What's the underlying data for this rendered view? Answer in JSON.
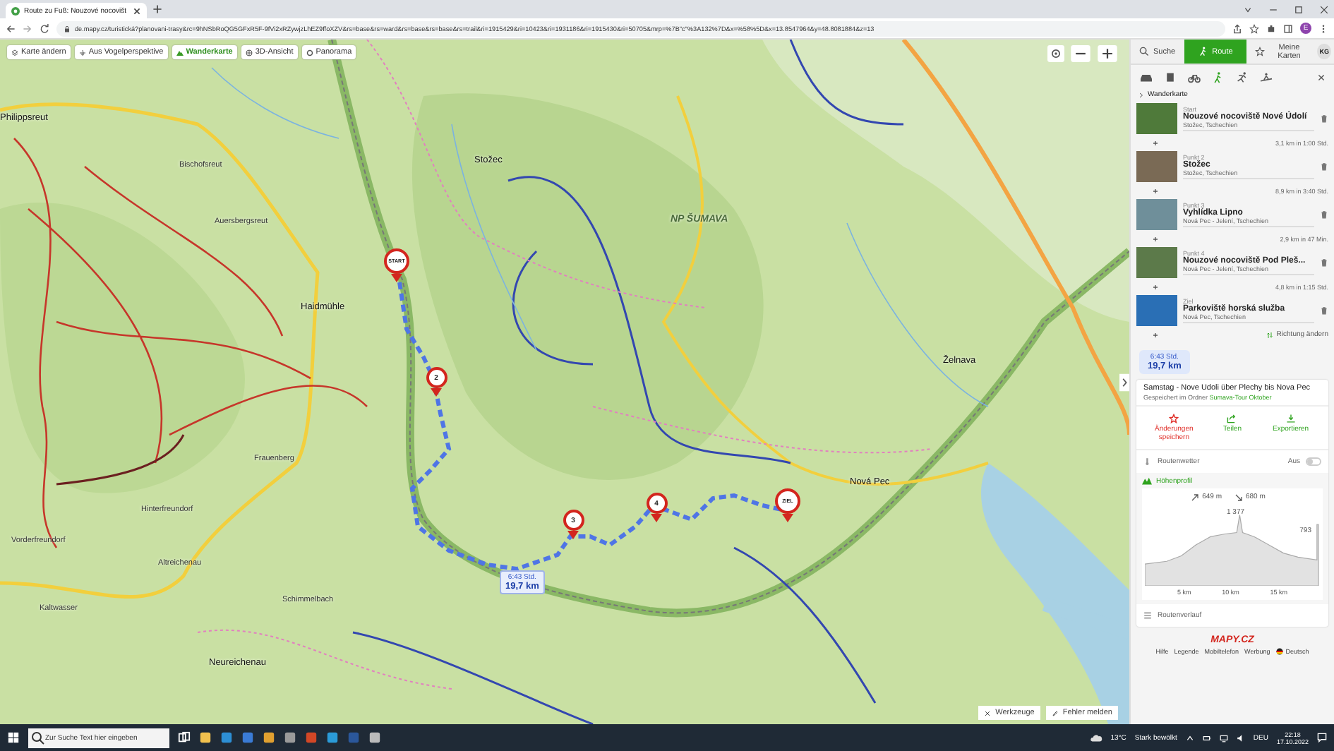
{
  "browser": {
    "tab_title": "Route zu Fuß: Nouzové nocovišt",
    "url": "de.mapy.cz/turistická?planovani-trasy&rc=9hNSbRoQG5GFxR5F-9fVi2xRZywjzLhEZ9ffoXZV&rs=base&rs=ward&rs=base&rs=base&rs=trail&ri=1915429&ri=10423&ri=1931186&ri=1915430&ri=50705&mrp=%7B\"c\"%3A132%7D&x=%58%5D&x=13.8547964&y=48.8081884&z=13",
    "profile_initial": "E"
  },
  "map": {
    "layers": [
      {
        "label": "Karte ändern",
        "kind": "layers",
        "selected": false
      },
      {
        "label": "Aus Vogelperspektive",
        "kind": "aerial",
        "selected": false
      },
      {
        "label": "Wanderkarte",
        "kind": "hiking",
        "selected": true
      },
      {
        "label": "3D-Ansicht",
        "kind": "globe",
        "selected": false
      },
      {
        "label": "Panorama",
        "kind": "panorama",
        "selected": false
      }
    ],
    "places": [
      {
        "name": "Stožec",
        "kind": "town"
      },
      {
        "name": "NP ŠUMAVA",
        "kind": "park"
      },
      {
        "name": "Philippsreut",
        "kind": "town"
      },
      {
        "name": "Bischofsreut",
        "kind": "village"
      },
      {
        "name": "Auersbergsreut",
        "kind": "village"
      },
      {
        "name": "Haidmühle",
        "kind": "town"
      },
      {
        "name": "Frauenberg",
        "kind": "village"
      },
      {
        "name": "Hinterfreundorf",
        "kind": "village"
      },
      {
        "name": "Vorderfreundorf",
        "kind": "village"
      },
      {
        "name": "Altreichenau",
        "kind": "village"
      },
      {
        "name": "Kaltwasser",
        "kind": "village"
      },
      {
        "name": "Schimmelbach",
        "kind": "village"
      },
      {
        "name": "Neureichenau",
        "kind": "town"
      },
      {
        "name": "Nová Pec",
        "kind": "town"
      },
      {
        "name": "Želnava",
        "kind": "town"
      }
    ],
    "markers": [
      {
        "label": "START",
        "kind": "endpoint"
      },
      {
        "label": "2",
        "kind": "waypoint"
      },
      {
        "label": "3",
        "kind": "waypoint"
      },
      {
        "label": "4",
        "kind": "waypoint"
      },
      {
        "label": "ZIEL",
        "kind": "endpoint"
      }
    ],
    "route_label": {
      "time": "6:43 Std.",
      "distance": "19,7 km"
    },
    "tools": [
      {
        "label": "Werkzeuge",
        "kind": "tools"
      },
      {
        "label": "Fehler melden",
        "kind": "report"
      }
    ]
  },
  "panel": {
    "tabs": [
      {
        "label": "Suche",
        "kind": "search",
        "selected": false
      },
      {
        "label": "Route",
        "kind": "route",
        "selected": true
      },
      {
        "label": "Meine Karten",
        "kind": "star",
        "selected": false
      }
    ],
    "avatar": "KG",
    "modes": [
      {
        "kind": "car",
        "selected": false
      },
      {
        "kind": "bus",
        "selected": false
      },
      {
        "kind": "bike",
        "selected": false
      },
      {
        "kind": "walk",
        "selected": true
      },
      {
        "kind": "run",
        "selected": false
      },
      {
        "kind": "ski",
        "selected": false
      }
    ],
    "breadcrumb": "Wanderkarte",
    "waypoints": [
      {
        "role": "Start",
        "name": "Nouzové nocoviště Nové Údolí",
        "place": "Stožec, Tschechien",
        "leg": "3,1 km in 1:00 Std."
      },
      {
        "role": "Punkt 2",
        "name": "Stožec",
        "place": "Stožec, Tschechien",
        "leg": "8,9 km in 3:40 Std."
      },
      {
        "role": "Punkt 3",
        "name": "Vyhlídka Lipno",
        "place": "Nová Pec - Jelení, Tschechien",
        "leg": "2,9 km in 47 Min."
      },
      {
        "role": "Punkt 4",
        "name": "Nouzové nocoviště Pod Pleš...",
        "place": "Nová Pec - Jelení, Tschechien",
        "leg": "4,8 km in 1:15 Std."
      },
      {
        "role": "Ziel",
        "name": "Parkoviště horská služba",
        "place": "Nová Pec, Tschechien"
      }
    ],
    "reverse": "Richtung ändern",
    "summary": {
      "time": "6:43 Std.",
      "distance": "19,7 km"
    },
    "title": "Samstag - Nove Udoli über Plechy bis Nova Pec",
    "saved_prefix": "Gespeichert im Ordner",
    "folder": "Sumava-Tour Oktober",
    "actions": [
      {
        "label": "Änderungen speichern",
        "kind": "save"
      },
      {
        "label": "Teilen",
        "kind": "share"
      },
      {
        "label": "Exportieren",
        "kind": "export"
      }
    ],
    "weather": {
      "label": "Routenwetter",
      "state": "Aus",
      "on": false
    },
    "profile": {
      "label": "Höhenprofil",
      "ascent": "649 m",
      "descent": "680 m",
      "peak": "1 377",
      "end": "793",
      "xticks": [
        "5 km",
        "10 km",
        "15 km"
      ]
    },
    "course": "Routenverlauf",
    "logo": "MAPY.CZ",
    "links": [
      "Hilfe",
      "Legende",
      "Mobiltelefon",
      "Werbung"
    ],
    "language": "Deutsch"
  },
  "taskbar": {
    "search_placeholder": "Zur Suche Text hier eingeben",
    "temperature": "13°C",
    "weather": "Stark bewölkt",
    "language": "DEU",
    "time": "22:18",
    "date": "17.10.2022"
  }
}
